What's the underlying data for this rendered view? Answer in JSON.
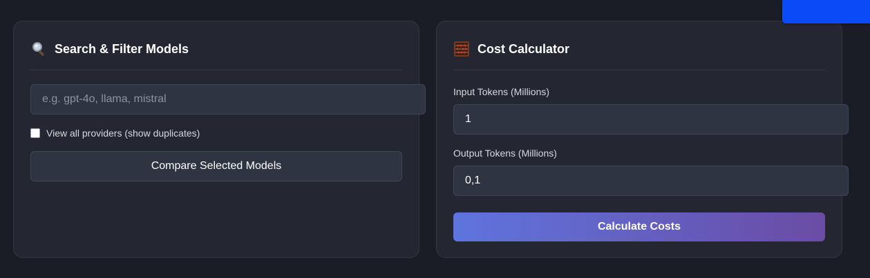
{
  "search_panel": {
    "icon": "magnifying-glass-icon",
    "title": "Search & Filter Models",
    "search_placeholder": "e.g. gpt-4o, llama, mistral",
    "search_value": "",
    "view_all_label": "View all providers (show duplicates)",
    "view_all_checked": false,
    "compare_label": "Compare Selected Models"
  },
  "calculator_panel": {
    "icon": "abacus-icon",
    "title": "Cost Calculator",
    "input_tokens_label": "Input Tokens (Millions)",
    "input_tokens_value": "1",
    "output_tokens_label": "Output Tokens (Millions)",
    "output_tokens_value": "0,1",
    "calculate_label": "Calculate Costs"
  },
  "colors": {
    "page_background": "#1a1c26",
    "panel_background": "#242631",
    "input_background": "#2e3442",
    "top_tab": "#0a4af7",
    "gradient_start": "#5f74de",
    "gradient_end": "#6a4ca4"
  }
}
